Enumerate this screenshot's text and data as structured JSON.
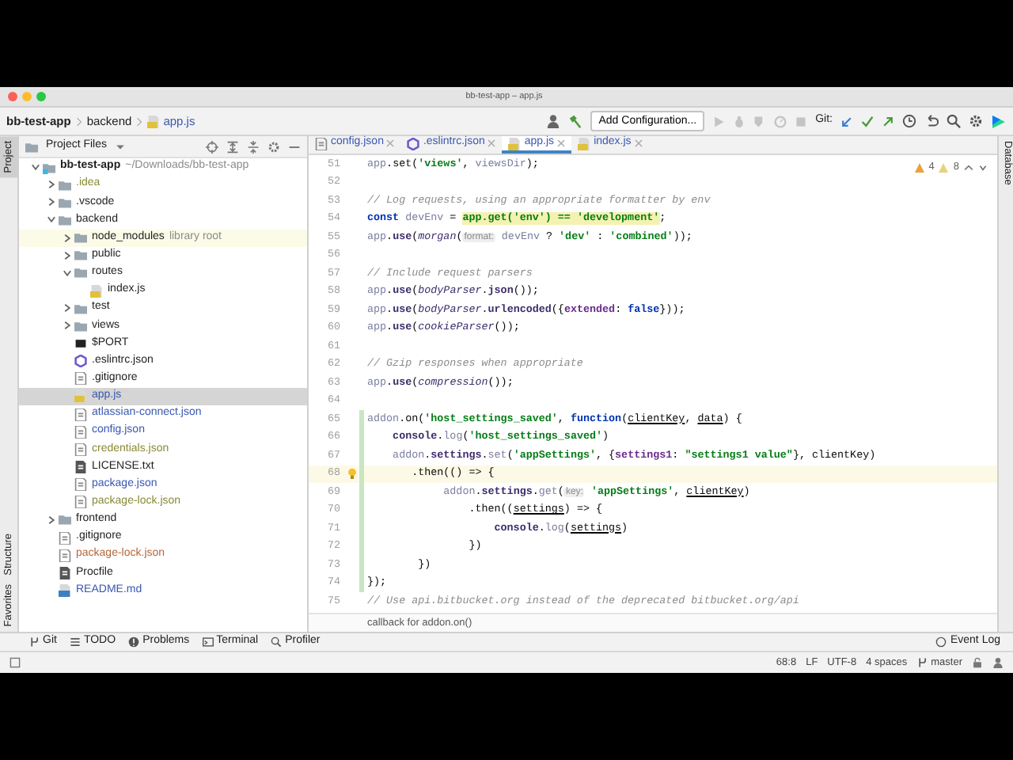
{
  "window": {
    "title": "bb-test-app – app.js"
  },
  "breadcrumbs": [
    {
      "label": "bb-test-app",
      "kind": "project"
    },
    {
      "label": "backend",
      "kind": "folder"
    },
    {
      "label": "app.js",
      "kind": "js"
    }
  ],
  "toolbar": {
    "run_config": "Add Configuration...",
    "git_label": "Git:"
  },
  "left_stripe_top": [
    {
      "label": "Project",
      "selected": true
    }
  ],
  "left_stripe_bottom": [
    {
      "label": "Structure",
      "selected": false
    },
    {
      "label": "Favorites",
      "selected": false
    }
  ],
  "right_stripe": [
    {
      "label": "Database"
    }
  ],
  "project": {
    "title": "Project Files",
    "tree": [
      {
        "label": "bb-test-app",
        "kind": "project",
        "note": "~/Downloads/bb-test-app",
        "expanded": true,
        "selected": false,
        "children": [
          {
            "label": ".idea",
            "kind": "folder",
            "expanded": false,
            "selected": false,
            "color": "#8a8a36"
          },
          {
            "label": ".vscode",
            "kind": "folder",
            "expanded": false,
            "selected": false
          },
          {
            "label": "backend",
            "kind": "folder",
            "expanded": true,
            "selected": false,
            "children": [
              {
                "label": "node_modules",
                "kind": "library",
                "note": "library root",
                "expanded": false,
                "selected": false
              },
              {
                "label": "public",
                "kind": "folder",
                "expanded": false,
                "selected": false
              },
              {
                "label": "routes",
                "kind": "folder",
                "expanded": true,
                "selected": false,
                "children": [
                  {
                    "label": "index.js",
                    "kind": "js",
                    "selected": false
                  }
                ]
              },
              {
                "label": "test",
                "kind": "folder",
                "expanded": false,
                "selected": false
              },
              {
                "label": "views",
                "kind": "folder",
                "expanded": false,
                "selected": false
              },
              {
                "label": "$PORT",
                "kind": "env",
                "selected": false
              },
              {
                "label": ".eslintrc.json",
                "kind": "eslint",
                "selected": false
              },
              {
                "label": ".gitignore",
                "kind": "config",
                "selected": false
              },
              {
                "label": "app.js",
                "kind": "js",
                "selected": true,
                "color": "#3a58b0"
              },
              {
                "label": "atlassian-connect.json",
                "kind": "config",
                "selected": false,
                "color": "#3a58b0"
              },
              {
                "label": "config.json",
                "kind": "config",
                "selected": false,
                "color": "#3a58b0"
              },
              {
                "label": "credentials.json",
                "kind": "config",
                "selected": false,
                "color": "#8a8a36"
              },
              {
                "label": "LICENSE.txt",
                "kind": "text",
                "selected": false
              },
              {
                "label": "package.json",
                "kind": "config",
                "selected": false,
                "color": "#3a58b0"
              },
              {
                "label": "package-lock.json",
                "kind": "config",
                "selected": false,
                "color": "#8a8a36"
              }
            ]
          },
          {
            "label": "frontend",
            "kind": "folder",
            "expanded": false,
            "selected": false
          },
          {
            "label": ".gitignore",
            "kind": "config",
            "selected": false
          },
          {
            "label": "package-lock.json",
            "kind": "config",
            "selected": false,
            "color": "#b4683c"
          },
          {
            "label": "Procfile",
            "kind": "text",
            "selected": false
          },
          {
            "label": "README.md",
            "kind": "md",
            "selected": false,
            "color": "#3a58b0"
          }
        ]
      }
    ]
  },
  "tabs": [
    {
      "label": "config.json",
      "kind": "config",
      "selected": false
    },
    {
      "label": ".eslintrc.json",
      "kind": "eslint",
      "selected": false
    },
    {
      "label": "app.js",
      "kind": "js",
      "selected": true
    },
    {
      "label": "index.js",
      "kind": "js",
      "selected": false
    }
  ],
  "inspections": {
    "warnings": "4",
    "weak_warnings": "8"
  },
  "code": [
    {
      "number": "51",
      "current": false,
      "changed": false,
      "bulb": false,
      "segments": [
        {
          "text": "app",
          "kind": "ident"
        },
        {
          "text": ".",
          "kind": "plain"
        },
        {
          "text": "set",
          "kind": "plain"
        },
        {
          "text": "(",
          "kind": "plain"
        },
        {
          "text": "'views'",
          "kind": "string"
        },
        {
          "text": ", ",
          "kind": "plain"
        },
        {
          "text": "viewsDir",
          "kind": "ident"
        },
        {
          "text": ");",
          "kind": "plain"
        }
      ]
    },
    {
      "number": "52",
      "current": false,
      "changed": false,
      "bulb": false
    },
    {
      "number": "53",
      "current": false,
      "changed": false,
      "bulb": false,
      "segments": [
        {
          "text": "// Log requests, using an appropriate formatter by env",
          "kind": "comment"
        }
      ]
    },
    {
      "number": "54",
      "current": false,
      "changed": false,
      "bulb": false,
      "segments": [
        {
          "text": "const",
          "kind": "keyword"
        },
        {
          "text": " devEnv",
          "kind": "ident"
        },
        {
          "text": " = ",
          "kind": "plain"
        },
        {
          "text": "app.get('env') == 'development'",
          "kind": "highlight"
        },
        {
          "text": ";",
          "kind": "plain"
        }
      ]
    },
    {
      "number": "55",
      "current": false,
      "changed": false,
      "bulb": false,
      "segments": [
        {
          "text": "app",
          "kind": "ident"
        },
        {
          "text": ".",
          "kind": "plain"
        },
        {
          "text": "use",
          "kind": "member"
        },
        {
          "text": "(",
          "kind": "plain"
        },
        {
          "text": "morgan",
          "kind": "italic"
        },
        {
          "text": "(",
          "kind": "plain"
        },
        {
          "text": "format:",
          "kind": "hint"
        },
        {
          "text": " devEnv",
          "kind": "ident"
        },
        {
          "text": " ? ",
          "kind": "plain"
        },
        {
          "text": "'dev'",
          "kind": "string"
        },
        {
          "text": " : ",
          "kind": "plain"
        },
        {
          "text": "'combined'",
          "kind": "string"
        },
        {
          "text": "));",
          "kind": "plain"
        }
      ]
    },
    {
      "number": "56",
      "current": false,
      "changed": false,
      "bulb": false
    },
    {
      "number": "57",
      "current": false,
      "changed": false,
      "bulb": false,
      "segments": [
        {
          "text": "// Include request parsers",
          "kind": "comment"
        }
      ]
    },
    {
      "number": "58",
      "current": false,
      "changed": false,
      "bulb": false,
      "segments": [
        {
          "text": "app",
          "kind": "ident"
        },
        {
          "text": ".",
          "kind": "plain"
        },
        {
          "text": "use",
          "kind": "member"
        },
        {
          "text": "(",
          "kind": "plain"
        },
        {
          "text": "bodyParser",
          "kind": "italic"
        },
        {
          "text": ".",
          "kind": "plain"
        },
        {
          "text": "json",
          "kind": "member"
        },
        {
          "text": "());",
          "kind": "plain"
        }
      ]
    },
    {
      "number": "59",
      "current": false,
      "changed": false,
      "bulb": false,
      "segments": [
        {
          "text": "app",
          "kind": "ident"
        },
        {
          "text": ".",
          "kind": "plain"
        },
        {
          "text": "use",
          "kind": "member"
        },
        {
          "text": "(",
          "kind": "plain"
        },
        {
          "text": "bodyParser",
          "kind": "italic"
        },
        {
          "text": ".",
          "kind": "plain"
        },
        {
          "text": "urlencoded",
          "kind": "member"
        },
        {
          "text": "({",
          "kind": "plain"
        },
        {
          "text": "extended",
          "kind": "property"
        },
        {
          "text": ": ",
          "kind": "plain"
        },
        {
          "text": "false",
          "kind": "keyword"
        },
        {
          "text": "}));",
          "kind": "plain"
        }
      ]
    },
    {
      "number": "60",
      "current": false,
      "changed": false,
      "bulb": false,
      "segments": [
        {
          "text": "app",
          "kind": "ident"
        },
        {
          "text": ".",
          "kind": "plain"
        },
        {
          "text": "use",
          "kind": "member"
        },
        {
          "text": "(",
          "kind": "plain"
        },
        {
          "text": "cookieParser",
          "kind": "italic"
        },
        {
          "text": "());",
          "kind": "plain"
        }
      ]
    },
    {
      "number": "61",
      "current": false,
      "changed": false,
      "bulb": false
    },
    {
      "number": "62",
      "current": false,
      "changed": false,
      "bulb": false,
      "segments": [
        {
          "text": "// Gzip responses when appropriate",
          "kind": "comment"
        }
      ]
    },
    {
      "number": "63",
      "current": false,
      "changed": false,
      "bulb": false,
      "segments": [
        {
          "text": "app",
          "kind": "ident"
        },
        {
          "text": ".",
          "kind": "plain"
        },
        {
          "text": "use",
          "kind": "member"
        },
        {
          "text": "(",
          "kind": "plain"
        },
        {
          "text": "compression",
          "kind": "italic"
        },
        {
          "text": "());",
          "kind": "plain"
        }
      ]
    },
    {
      "number": "64",
      "current": false,
      "changed": false,
      "bulb": false
    },
    {
      "number": "65",
      "current": false,
      "changed": true,
      "bulb": false,
      "segments": [
        {
          "text": "addon",
          "kind": "ident"
        },
        {
          "text": ".on(",
          "kind": "plain"
        },
        {
          "text": "'host_settings_saved'",
          "kind": "string"
        },
        {
          "text": ", ",
          "kind": "plain"
        },
        {
          "text": "function",
          "kind": "keyword"
        },
        {
          "text": "(",
          "kind": "plain"
        },
        {
          "text": "clientKey",
          "kind": "param"
        },
        {
          "text": ", ",
          "kind": "plain"
        },
        {
          "text": "data",
          "kind": "param"
        },
        {
          "text": ") {",
          "kind": "plain"
        }
      ]
    },
    {
      "number": "66",
      "current": false,
      "changed": true,
      "bulb": false,
      "segments": [
        {
          "text": "    console",
          "kind": "member"
        },
        {
          "text": ".",
          "kind": "plain"
        },
        {
          "text": "log",
          "kind": "ident"
        },
        {
          "text": "(",
          "kind": "plain"
        },
        {
          "text": "'host_settings_saved'",
          "kind": "string"
        },
        {
          "text": ")",
          "kind": "plain"
        }
      ]
    },
    {
      "number": "67",
      "current": false,
      "changed": true,
      "bulb": false,
      "segments": [
        {
          "text": "    addon",
          "kind": "ident"
        },
        {
          "text": ".",
          "kind": "plain"
        },
        {
          "text": "settings",
          "kind": "member"
        },
        {
          "text": ".",
          "kind": "plain"
        },
        {
          "text": "set",
          "kind": "ident"
        },
        {
          "text": "(",
          "kind": "plain"
        },
        {
          "text": "'appSettings'",
          "kind": "string"
        },
        {
          "text": ", {",
          "kind": "plain"
        },
        {
          "text": "settings1",
          "kind": "property"
        },
        {
          "text": ": ",
          "kind": "plain"
        },
        {
          "text": "\"settings1 value\"",
          "kind": "string"
        },
        {
          "text": "}, clientKey)",
          "kind": "plain"
        }
      ]
    },
    {
      "number": "68",
      "current": true,
      "changed": true,
      "bulb": true,
      "segments": [
        {
          "text": "       .then(() => {",
          "kind": "plain"
        }
      ]
    },
    {
      "number": "69",
      "current": false,
      "changed": true,
      "bulb": false,
      "segments": [
        {
          "text": "            addon",
          "kind": "ident"
        },
        {
          "text": ".",
          "kind": "plain"
        },
        {
          "text": "settings",
          "kind": "member"
        },
        {
          "text": ".",
          "kind": "plain"
        },
        {
          "text": "get",
          "kind": "ident"
        },
        {
          "text": "(",
          "kind": "plain"
        },
        {
          "text": "key:",
          "kind": "hint"
        },
        {
          "text": " 'appSettings'",
          "kind": "string"
        },
        {
          "text": ", ",
          "kind": "plain"
        },
        {
          "text": "clientKey",
          "kind": "param"
        },
        {
          "text": ")",
          "kind": "plain"
        }
      ]
    },
    {
      "number": "70",
      "current": false,
      "changed": true,
      "bulb": false,
      "segments": [
        {
          "text": "                .then((",
          "kind": "plain"
        },
        {
          "text": "settings",
          "kind": "param"
        },
        {
          "text": ") => {",
          "kind": "plain"
        }
      ]
    },
    {
      "number": "71",
      "current": false,
      "changed": true,
      "bulb": false,
      "segments": [
        {
          "text": "                    console",
          "kind": "member"
        },
        {
          "text": ".",
          "kind": "plain"
        },
        {
          "text": "log",
          "kind": "ident"
        },
        {
          "text": "(",
          "kind": "plain"
        },
        {
          "text": "settings",
          "kind": "param"
        },
        {
          "text": ")",
          "kind": "plain"
        }
      ]
    },
    {
      "number": "72",
      "current": false,
      "changed": true,
      "bulb": false,
      "segments": [
        {
          "text": "                })",
          "kind": "plain"
        }
      ]
    },
    {
      "number": "73",
      "current": false,
      "changed": true,
      "bulb": false,
      "segments": [
        {
          "text": "        })",
          "kind": "plain"
        }
      ]
    },
    {
      "number": "74",
      "current": false,
      "changed": true,
      "bulb": false,
      "segments": [
        {
          "text": "});",
          "kind": "plain"
        }
      ]
    },
    {
      "number": "75",
      "current": false,
      "changed": false,
      "bulb": false,
      "segments": [
        {
          "text": "// Use api.bitbucket.org instead of the deprecated bitbucket.org/api",
          "kind": "comment"
        }
      ]
    }
  ],
  "breadcrumb_hint": "callback for addon.on()",
  "tool_windows": [
    {
      "label": "Git",
      "kind": "git"
    },
    {
      "label": "TODO",
      "kind": "todo"
    },
    {
      "label": "Problems",
      "kind": "problems"
    },
    {
      "label": "Terminal",
      "kind": "terminal"
    },
    {
      "label": "Profiler",
      "kind": "profiler"
    }
  ],
  "event_log": "Event Log",
  "status": [
    "68:8",
    "LF",
    "UTF-8",
    "4 spaces"
  ],
  "branch": "master"
}
